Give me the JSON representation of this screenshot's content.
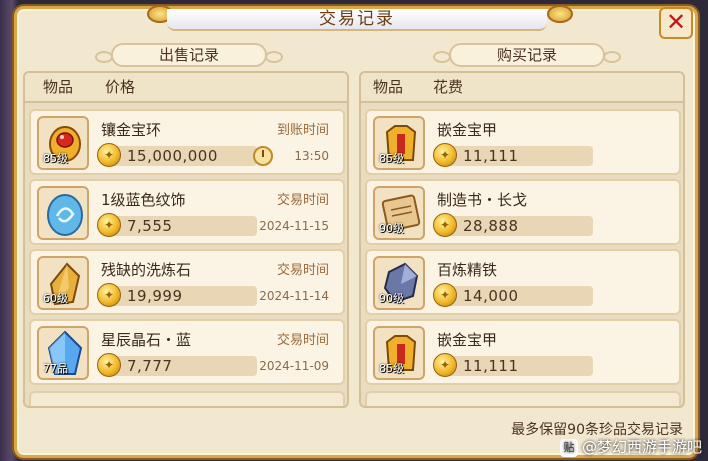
{
  "window": {
    "title": "交易记录",
    "close": "✕"
  },
  "sell": {
    "header": "出售记录",
    "col_item": "物品",
    "col_price": "价格",
    "rows": [
      {
        "name": "镶金宝环",
        "level": "85级",
        "price": "15,000,000",
        "time_label": "到账时间",
        "time_value": "13:50",
        "icon": "gold-ring-icon"
      },
      {
        "name": "1级蓝色纹饰",
        "level": "",
        "price": "7,555",
        "time_label": "交易时间",
        "time_value": "2024-11-15",
        "icon": "blue-ornament-icon"
      },
      {
        "name": "残缺的洗炼石",
        "level": "60级",
        "price": "19,999",
        "time_label": "交易时间",
        "time_value": "2024-11-14",
        "icon": "refine-stone-icon"
      },
      {
        "name": "星辰晶石・蓝",
        "level": "77品",
        "price": "7,777",
        "time_label": "交易时间",
        "time_value": "2024-11-09",
        "icon": "blue-crystal-icon"
      }
    ]
  },
  "buy": {
    "header": "购买记录",
    "col_item": "物品",
    "col_price": "花费",
    "rows": [
      {
        "name": "嵌金宝甲",
        "level": "85级",
        "price": "11,111",
        "icon": "gold-armor-icon"
      },
      {
        "name": "制造书・长戈",
        "level": "90级",
        "price": "28,888",
        "icon": "scroll-book-icon"
      },
      {
        "name": "百炼精铁",
        "level": "90级",
        "price": "14,000",
        "icon": "refined-iron-icon"
      },
      {
        "name": "嵌金宝甲",
        "level": "85级",
        "price": "11,111",
        "icon": "gold-armor-icon"
      }
    ]
  },
  "footer_note": "最多保留90条珍品交易记录",
  "watermark": "@梦幻西游手游吧",
  "watermark_logo": "贴",
  "colors": {
    "panel": "#f2e7cf",
    "border": "#d9a64a",
    "close": "#c0171b"
  }
}
